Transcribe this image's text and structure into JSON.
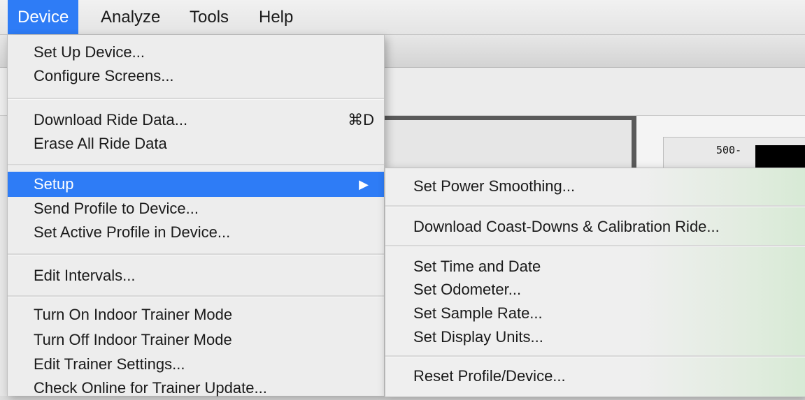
{
  "menubar": {
    "items": [
      {
        "label": "Device",
        "active": true
      },
      {
        "label": "Analyze"
      },
      {
        "label": "Tools"
      },
      {
        "label": "Help"
      }
    ]
  },
  "graph": {
    "tick_label": "500-"
  },
  "device_menu": {
    "items": [
      {
        "label": "Set Up Device..."
      },
      {
        "label": "Configure Screens..."
      },
      {
        "label": "Download Ride Data...",
        "shortcut": "⌘D"
      },
      {
        "label": "Erase All Ride Data"
      },
      {
        "label": "Setup",
        "submenu_arrow": "▶",
        "highlighted": true
      },
      {
        "label": "Send Profile to Device..."
      },
      {
        "label": "Set Active Profile in Device..."
      },
      {
        "label": "Edit Intervals..."
      },
      {
        "label": "Turn On Indoor Trainer Mode"
      },
      {
        "label": "Turn Off Indoor Trainer Mode"
      },
      {
        "label": "Edit Trainer Settings..."
      },
      {
        "label": "Check Online for Trainer Update..."
      }
    ]
  },
  "setup_submenu": {
    "items": [
      {
        "label": "Set Power Smoothing..."
      },
      {
        "label": "Download Coast-Downs & Calibration Ride..."
      },
      {
        "label": "Set Time and Date"
      },
      {
        "label": "Set Odometer..."
      },
      {
        "label": "Set Sample Rate..."
      },
      {
        "label": "Set Display Units..."
      },
      {
        "label": "Reset Profile/Device..."
      }
    ]
  },
  "colors": {
    "accent": "#2e7cf6"
  }
}
